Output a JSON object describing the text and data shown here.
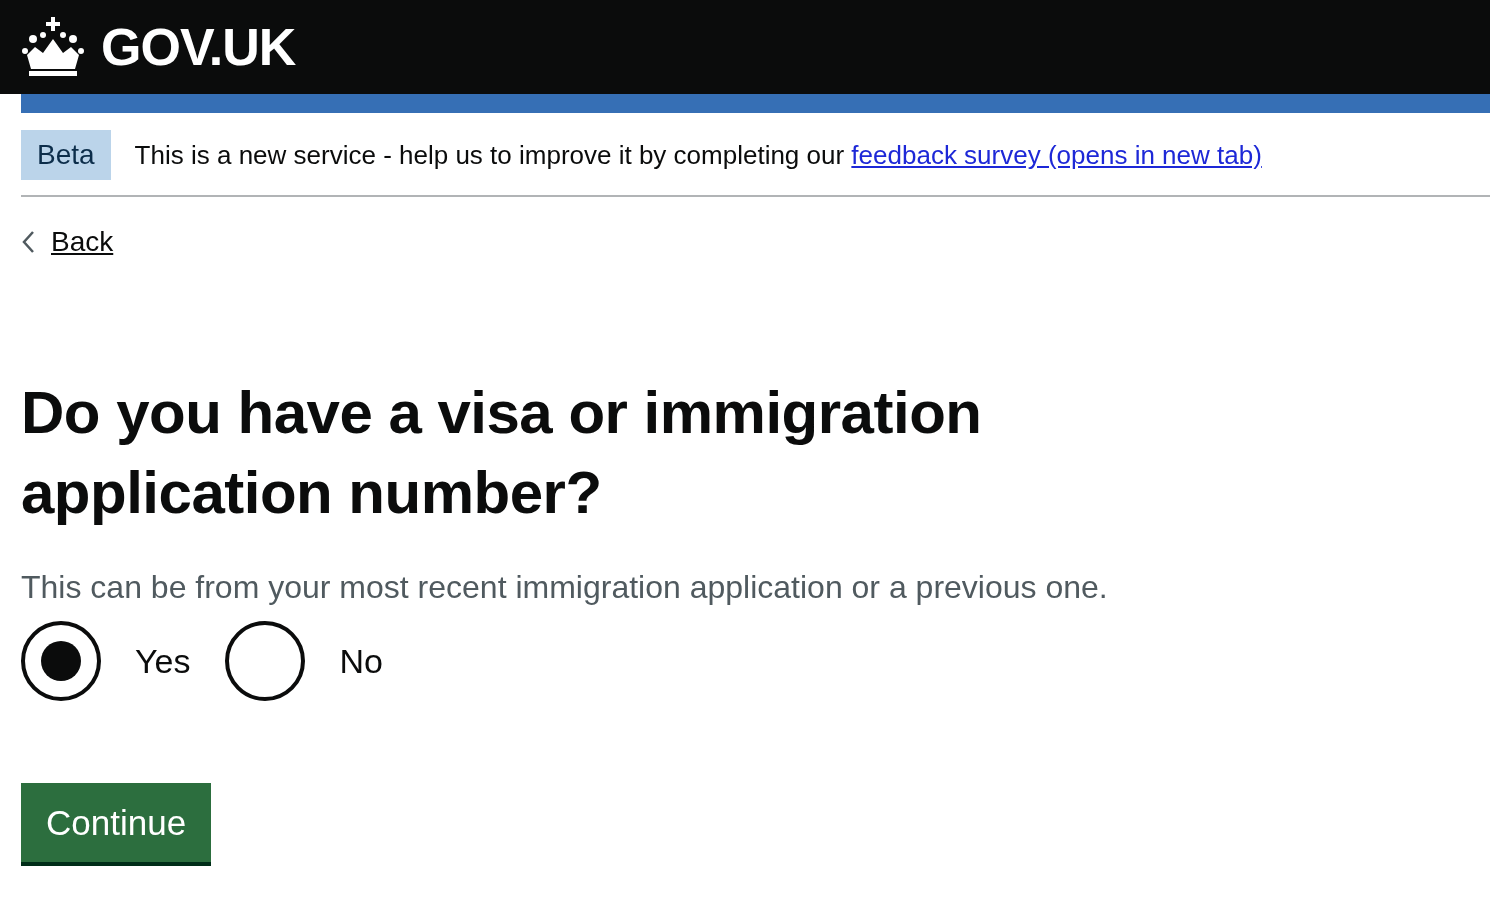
{
  "header": {
    "logo_text": "GOV.UK"
  },
  "phase_banner": {
    "tag": "Beta",
    "text": "This is a new service - help us to improve it by completing our ",
    "link": "feedback survey (opens in new tab)"
  },
  "back_link": "Back",
  "question": {
    "heading": "Do you have a visa or immigration application number?",
    "hint": "This can be from your most recent immigration application or a previous one.",
    "options": [
      {
        "label": "Yes",
        "selected": true
      },
      {
        "label": "No",
        "selected": false
      }
    ]
  },
  "button": "Continue"
}
